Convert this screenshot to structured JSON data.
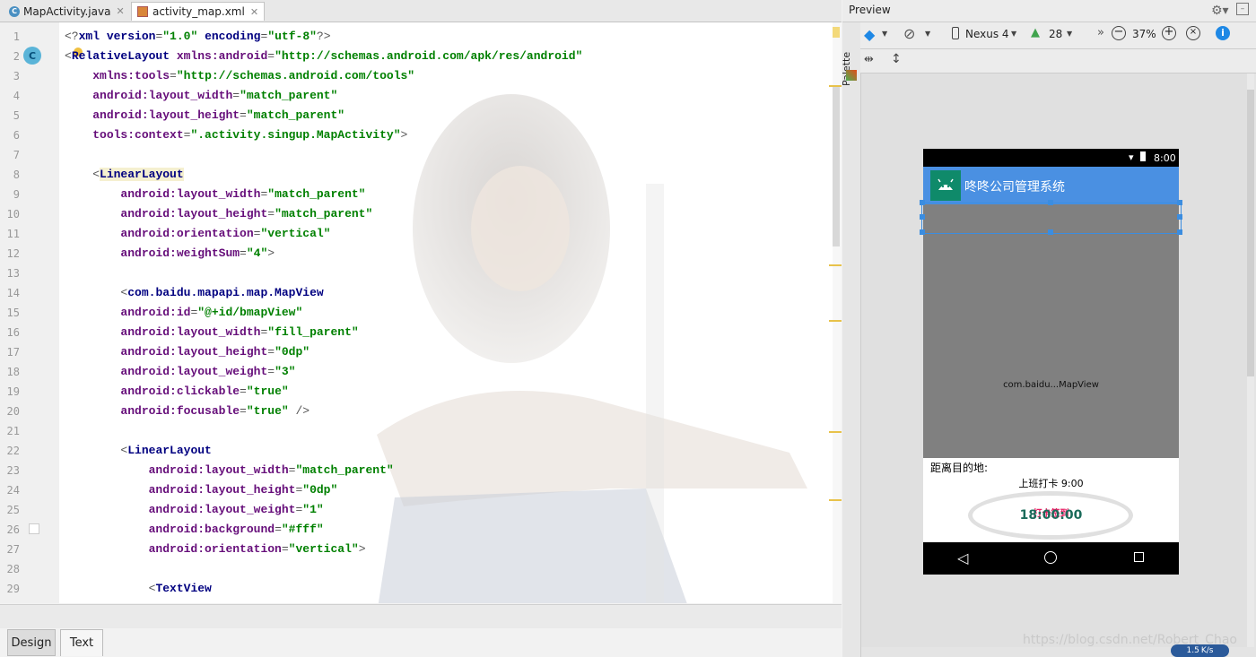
{
  "tabs": [
    {
      "label": "MapActivity.java",
      "icon": "java-class-icon"
    },
    {
      "label": "activity_map.xml",
      "icon": "xml-file-icon"
    }
  ],
  "editor": {
    "lines": [
      {
        "n": "1",
        "html": "<span class='p'>&lt;?</span><span class='t'>xml version</span><span class='p'>=</span><span class='v'>\"1.0\"</span> <span class='t'>encoding</span><span class='p'>=</span><span class='v'>\"utf-8\"</span><span class='p'>?&gt;</span>"
      },
      {
        "n": "2",
        "html": "<span class='p'>&lt;</span><span class='t'>RelativeLayout</span> <span class='a'>xmlns:android</span><span class='p'>=</span><span class='v'>\"http://schemas.android.com/apk/res/android\"</span>"
      },
      {
        "n": "3",
        "html": "    <span class='a'>xmlns:tools</span><span class='p'>=</span><span class='v'>\"http://schemas.android.com/tools\"</span>"
      },
      {
        "n": "4",
        "html": "    <span class='a'>android:layout_width</span><span class='p'>=</span><span class='v'>\"match_parent\"</span>"
      },
      {
        "n": "5",
        "html": "    <span class='a'>android:layout_height</span><span class='p'>=</span><span class='v'>\"match_parent\"</span>"
      },
      {
        "n": "6",
        "html": "    <span class='a'>tools:context</span><span class='p'>=</span><span class='v'>\".activity.singup.MapActivity\"</span><span class='p'>&gt;</span>"
      },
      {
        "n": "7",
        "html": ""
      },
      {
        "n": "8",
        "html": "    <span class='p'>&lt;</span><span class='t' style='background:#f5f0d0'>LinearLayout</span>"
      },
      {
        "n": "9",
        "html": "        <span class='a'>android:layout_width</span><span class='p'>=</span><span class='v'>\"match_parent\"</span>"
      },
      {
        "n": "10",
        "html": "        <span class='a'>android:layout_height</span><span class='p'>=</span><span class='v'>\"match_parent\"</span>"
      },
      {
        "n": "11",
        "html": "        <span class='a'>android:orientation</span><span class='p'>=</span><span class='v'>\"vertical\"</span>"
      },
      {
        "n": "12",
        "html": "        <span class='a'>android:weightSum</span><span class='p'>=</span><span class='v'>\"4\"</span><span class='p'>&gt;</span>"
      },
      {
        "n": "13",
        "html": ""
      },
      {
        "n": "14",
        "html": "        <span class='p'>&lt;</span><span class='t'>com.baidu.mapapi.map.MapView</span>"
      },
      {
        "n": "15",
        "html": "        <span class='a'>android:id</span><span class='p'>=</span><span class='v'>\"@+id/bmapView\"</span>"
      },
      {
        "n": "16",
        "html": "        <span class='a'>android:layout_width</span><span class='p'>=</span><span class='v'>\"fill_parent\"</span>"
      },
      {
        "n": "17",
        "html": "        <span class='a'>android:layout_height</span><span class='p'>=</span><span class='v'>\"0dp\"</span>"
      },
      {
        "n": "18",
        "html": "        <span class='a'>android:layout_weight</span><span class='p'>=</span><span class='v'>\"3\"</span>"
      },
      {
        "n": "19",
        "html": "        <span class='a'>android:clickable</span><span class='p'>=</span><span class='v'>\"true\"</span>"
      },
      {
        "n": "20",
        "html": "        <span class='a'>android:focusable</span><span class='p'>=</span><span class='v'>\"true\"</span> <span class='p'>/&gt;</span>"
      },
      {
        "n": "21",
        "html": ""
      },
      {
        "n": "22",
        "html": "        <span class='p'>&lt;</span><span class='t'>LinearLayout</span>"
      },
      {
        "n": "23",
        "html": "            <span class='a'>android:layout_width</span><span class='p'>=</span><span class='v'>\"match_parent\"</span>"
      },
      {
        "n": "24",
        "html": "            <span class='a'>android:layout_height</span><span class='p'>=</span><span class='v'>\"0dp\"</span>"
      },
      {
        "n": "25",
        "html": "            <span class='a'>android:layout_weight</span><span class='p'>=</span><span class='v'>\"1\"</span>"
      },
      {
        "n": "26",
        "html": "            <span class='a'>android:background</span><span class='p'>=</span><span class='v'>\"#fff\"</span>"
      },
      {
        "n": "27",
        "html": "            <span class='a'>android:orientation</span><span class='p'>=</span><span class='v'>\"vertical\"</span><span class='p'>&gt;</span>"
      },
      {
        "n": "28",
        "html": ""
      },
      {
        "n": "29",
        "html": "            <span class='p'>&lt;</span><span class='t'>TextView</span>"
      }
    ]
  },
  "bottom_tabs": {
    "design": "Design",
    "text": "Text"
  },
  "preview": {
    "title": "Preview",
    "device": "Nexus 4",
    "api": "28",
    "zoom": "37%"
  },
  "palette": {
    "label": "Palette"
  },
  "phone": {
    "time": "8:00",
    "app_title": "咚咚公司管理系统",
    "map_label": "com.baidu...MapView",
    "distance_label": "距离目的地:",
    "checkin_label": "上班打卡 9:00",
    "button_text": "打卡签到",
    "clock_text": "18:00:00"
  },
  "watermark": {
    "text": "https://blog.csdn.net/Robert_Chao",
    "speed": "1.5"
  }
}
